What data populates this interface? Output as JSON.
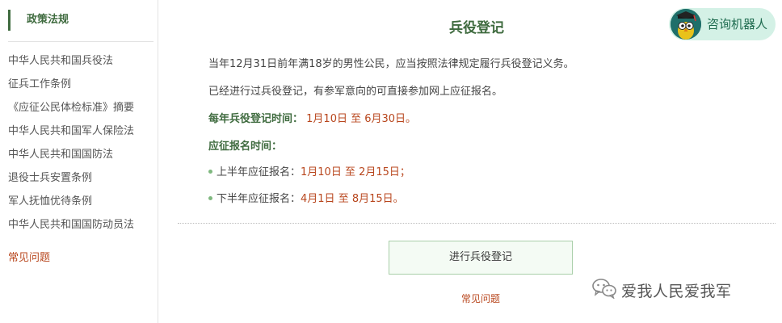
{
  "sidebar": {
    "heading": "政策法规",
    "items": [
      {
        "label": "中华人民共和国兵役法"
      },
      {
        "label": "征兵工作条例"
      },
      {
        "label": "《应征公民体检标准》摘要"
      },
      {
        "label": "中华人民共和国军人保险法"
      },
      {
        "label": "中华人民共和国国防法"
      },
      {
        "label": "退役士兵安置条例"
      },
      {
        "label": "军人抚恤优待条例"
      },
      {
        "label": "中华人民共和国国防动员法"
      }
    ],
    "faq_label": "常见问题"
  },
  "main": {
    "title": "兵役登记",
    "robot_label": "咨询机器人",
    "para1": "当年12月31日前年满18岁的男性公民，应当按照法律规定履行兵役登记义务。",
    "para2": "已经进行过兵役登记，有参军意向的可直接参加网上应征报名。",
    "registration_time_label": "每年兵役登记时间：",
    "registration_time_value": "1月10日 至 6月30日。",
    "enlist_time_label": "应征报名时间：",
    "first_half_label": "上半年应征报名：",
    "first_half_value": "1月10日 至 2月15日；",
    "second_half_label": "下半年应征报名：",
    "second_half_value": "4月1日 至 8月15日。",
    "register_button": "进行兵役登记",
    "faq_link": "常见问题"
  },
  "watermark": {
    "text": "爱我人民爱我军",
    "icon": "wechat-icon"
  },
  "colors": {
    "accent_green": "#3f6b3f",
    "highlight_red": "#b8461d",
    "robot_bg": "#d4f1e6"
  }
}
